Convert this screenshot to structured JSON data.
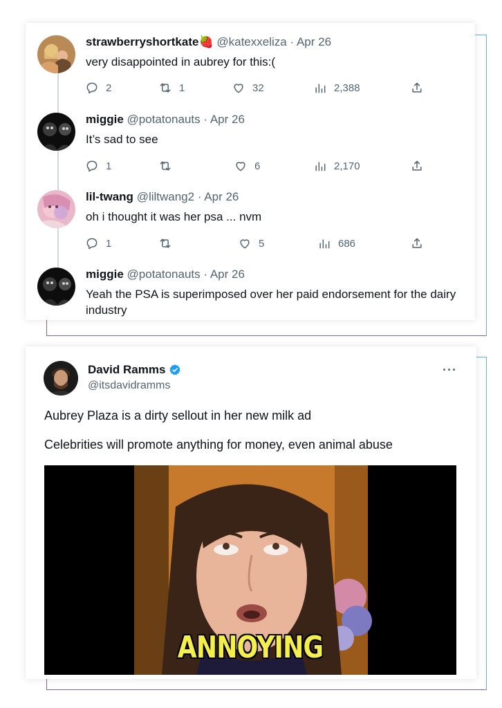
{
  "thread": {
    "replies": [
      {
        "name": "strawberryshortkate🍓",
        "handle": "@katexxeliza",
        "date": "Apr 26",
        "text": "very disappointed in aubrey for this:(",
        "stats": {
          "replies": "2",
          "reposts": "1",
          "likes": "32",
          "views": "2,388"
        }
      },
      {
        "name": "miggie",
        "handle": "@potatonauts",
        "date": "Apr 26",
        "text": "It’s sad to see",
        "stats": {
          "replies": "1",
          "reposts": "",
          "likes": "6",
          "views": "2,170"
        }
      },
      {
        "name": "lil-twang",
        "handle": "@liltwang2",
        "date": "Apr 26",
        "text": "oh i thought it was her psa ... nvm",
        "stats": {
          "replies": "1",
          "reposts": "",
          "likes": "5",
          "views": "686"
        }
      },
      {
        "name": "miggie",
        "handle": "@potatonauts",
        "date": "Apr 26",
        "text": "Yeah the PSA is superimposed over her paid endorsement for the dairy industry"
      }
    ]
  },
  "tweet": {
    "name": "David Ramms",
    "handle": "@itsdavidramms",
    "more": "···",
    "text1": "Aubrey Plaza is a dirty sellout in her new milk ad",
    "text2": "Celebrities will promote anything for money, even animal abuse",
    "media_caption": "ANNOYING"
  },
  "icons": {
    "reply": "reply-icon",
    "repost": "repost-icon",
    "like": "heart-icon",
    "views": "views-icon",
    "share": "share-icon",
    "verified": "verified-badge-icon"
  },
  "colors": {
    "text": "#0f1419",
    "secondary": "#536471",
    "verified": "#1d9bf0",
    "caption": "#f4ef4c",
    "frame_blue": "#5bb4d4",
    "frame_purple": "#7b61a8"
  }
}
